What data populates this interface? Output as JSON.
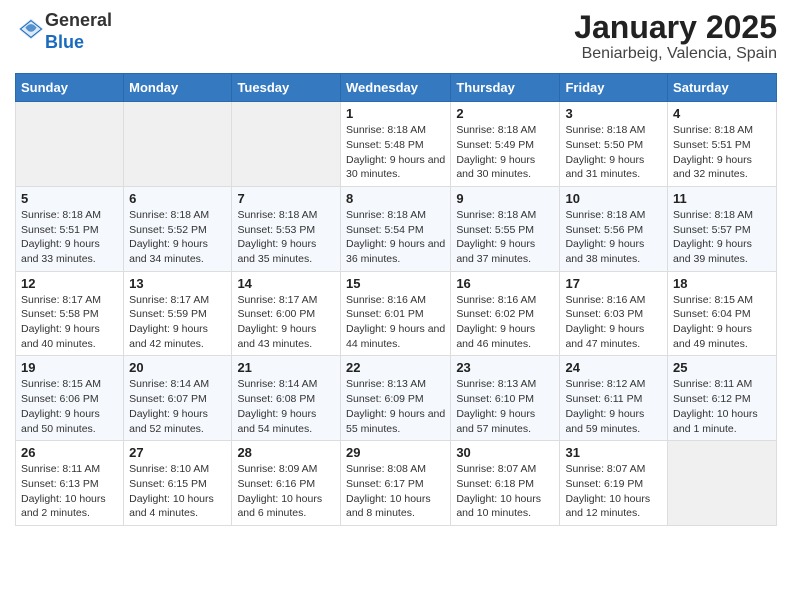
{
  "header": {
    "logo_general": "General",
    "logo_blue": "Blue",
    "month_title": "January 2025",
    "location": "Beniarbeig, Valencia, Spain"
  },
  "weekdays": [
    "Sunday",
    "Monday",
    "Tuesday",
    "Wednesday",
    "Thursday",
    "Friday",
    "Saturday"
  ],
  "weeks": [
    [
      {
        "day": "",
        "info": ""
      },
      {
        "day": "",
        "info": ""
      },
      {
        "day": "",
        "info": ""
      },
      {
        "day": "1",
        "info": "Sunrise: 8:18 AM\nSunset: 5:48 PM\nDaylight: 9 hours and 30 minutes."
      },
      {
        "day": "2",
        "info": "Sunrise: 8:18 AM\nSunset: 5:49 PM\nDaylight: 9 hours and 30 minutes."
      },
      {
        "day": "3",
        "info": "Sunrise: 8:18 AM\nSunset: 5:50 PM\nDaylight: 9 hours and 31 minutes."
      },
      {
        "day": "4",
        "info": "Sunrise: 8:18 AM\nSunset: 5:51 PM\nDaylight: 9 hours and 32 minutes."
      }
    ],
    [
      {
        "day": "5",
        "info": "Sunrise: 8:18 AM\nSunset: 5:51 PM\nDaylight: 9 hours and 33 minutes."
      },
      {
        "day": "6",
        "info": "Sunrise: 8:18 AM\nSunset: 5:52 PM\nDaylight: 9 hours and 34 minutes."
      },
      {
        "day": "7",
        "info": "Sunrise: 8:18 AM\nSunset: 5:53 PM\nDaylight: 9 hours and 35 minutes."
      },
      {
        "day": "8",
        "info": "Sunrise: 8:18 AM\nSunset: 5:54 PM\nDaylight: 9 hours and 36 minutes."
      },
      {
        "day": "9",
        "info": "Sunrise: 8:18 AM\nSunset: 5:55 PM\nDaylight: 9 hours and 37 minutes."
      },
      {
        "day": "10",
        "info": "Sunrise: 8:18 AM\nSunset: 5:56 PM\nDaylight: 9 hours and 38 minutes."
      },
      {
        "day": "11",
        "info": "Sunrise: 8:18 AM\nSunset: 5:57 PM\nDaylight: 9 hours and 39 minutes."
      }
    ],
    [
      {
        "day": "12",
        "info": "Sunrise: 8:17 AM\nSunset: 5:58 PM\nDaylight: 9 hours and 40 minutes."
      },
      {
        "day": "13",
        "info": "Sunrise: 8:17 AM\nSunset: 5:59 PM\nDaylight: 9 hours and 42 minutes."
      },
      {
        "day": "14",
        "info": "Sunrise: 8:17 AM\nSunset: 6:00 PM\nDaylight: 9 hours and 43 minutes."
      },
      {
        "day": "15",
        "info": "Sunrise: 8:16 AM\nSunset: 6:01 PM\nDaylight: 9 hours and 44 minutes."
      },
      {
        "day": "16",
        "info": "Sunrise: 8:16 AM\nSunset: 6:02 PM\nDaylight: 9 hours and 46 minutes."
      },
      {
        "day": "17",
        "info": "Sunrise: 8:16 AM\nSunset: 6:03 PM\nDaylight: 9 hours and 47 minutes."
      },
      {
        "day": "18",
        "info": "Sunrise: 8:15 AM\nSunset: 6:04 PM\nDaylight: 9 hours and 49 minutes."
      }
    ],
    [
      {
        "day": "19",
        "info": "Sunrise: 8:15 AM\nSunset: 6:06 PM\nDaylight: 9 hours and 50 minutes."
      },
      {
        "day": "20",
        "info": "Sunrise: 8:14 AM\nSunset: 6:07 PM\nDaylight: 9 hours and 52 minutes."
      },
      {
        "day": "21",
        "info": "Sunrise: 8:14 AM\nSunset: 6:08 PM\nDaylight: 9 hours and 54 minutes."
      },
      {
        "day": "22",
        "info": "Sunrise: 8:13 AM\nSunset: 6:09 PM\nDaylight: 9 hours and 55 minutes."
      },
      {
        "day": "23",
        "info": "Sunrise: 8:13 AM\nSunset: 6:10 PM\nDaylight: 9 hours and 57 minutes."
      },
      {
        "day": "24",
        "info": "Sunrise: 8:12 AM\nSunset: 6:11 PM\nDaylight: 9 hours and 59 minutes."
      },
      {
        "day": "25",
        "info": "Sunrise: 8:11 AM\nSunset: 6:12 PM\nDaylight: 10 hours and 1 minute."
      }
    ],
    [
      {
        "day": "26",
        "info": "Sunrise: 8:11 AM\nSunset: 6:13 PM\nDaylight: 10 hours and 2 minutes."
      },
      {
        "day": "27",
        "info": "Sunrise: 8:10 AM\nSunset: 6:15 PM\nDaylight: 10 hours and 4 minutes."
      },
      {
        "day": "28",
        "info": "Sunrise: 8:09 AM\nSunset: 6:16 PM\nDaylight: 10 hours and 6 minutes."
      },
      {
        "day": "29",
        "info": "Sunrise: 8:08 AM\nSunset: 6:17 PM\nDaylight: 10 hours and 8 minutes."
      },
      {
        "day": "30",
        "info": "Sunrise: 8:07 AM\nSunset: 6:18 PM\nDaylight: 10 hours and 10 minutes."
      },
      {
        "day": "31",
        "info": "Sunrise: 8:07 AM\nSunset: 6:19 PM\nDaylight: 10 hours and 12 minutes."
      },
      {
        "day": "",
        "info": ""
      }
    ]
  ]
}
